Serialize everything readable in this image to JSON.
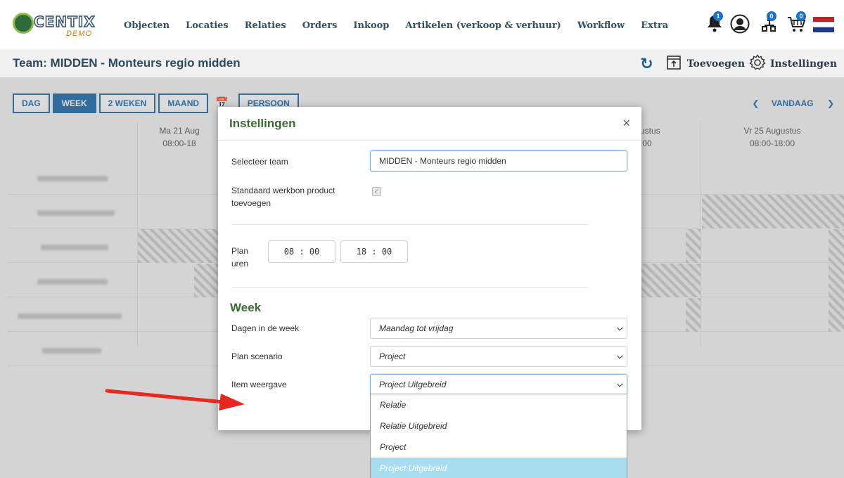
{
  "logo": {
    "text": "CENTIX",
    "sub": "DEMO"
  },
  "nav": [
    "Objecten",
    "Locaties",
    "Relaties",
    "Orders",
    "Inkoop",
    "Artikelen (verkoop & verhuur)",
    "Workflow",
    "Extra"
  ],
  "nav_icons": {
    "bell_badge": "1",
    "team_badge": "0",
    "cart_badge": "0",
    "flag": "netherlands-flag"
  },
  "page_title": "Team: MIDDEN - Monteurs regio midden",
  "header_actions": {
    "add": "Toevoegen",
    "settings": "Instellingen"
  },
  "planner": {
    "views": [
      "DAG",
      "WEEK",
      "2 WEKEN",
      "MAAND",
      "PERSOON"
    ],
    "active_view": "WEEK",
    "today": "VANDAAG",
    "days": [
      {
        "label": "Ma 21 Aug",
        "hours": "08:00-18"
      },
      {
        "label": "ustus",
        "hours": ":00"
      },
      {
        "label": "Vr 25 Augustus",
        "hours": "08:00-18:00"
      }
    ]
  },
  "modal": {
    "title": "Instellingen",
    "close": "×",
    "team_label": "Selecteer team",
    "team_value": "MIDDEN - Monteurs regio midden",
    "product_label": "Standaard werkbon product toevoegen",
    "product_checked": "✓",
    "hours_label_1": "Plan",
    "hours_label_2": "uren",
    "start_time": "08 : 00",
    "end_time": "18 : 00",
    "week_section": "Week",
    "days_label": "Dagen in de week",
    "days_value": "Maandag tot vrijdag",
    "scenario_label": "Plan scenario",
    "scenario_value": "Project",
    "display_label": "Item weergave",
    "display_value": "Project Uitgebreid",
    "display_options": [
      "Relatie",
      "Relatie Uitgebreid",
      "Project",
      "Project Uitgebreid"
    ],
    "selected_option_index": 3
  },
  "colors": {
    "primary": "#1b6cae",
    "modal_title": "#3d6b35",
    "selected_option": "#a9dcef",
    "arrow": "#e8271e"
  }
}
